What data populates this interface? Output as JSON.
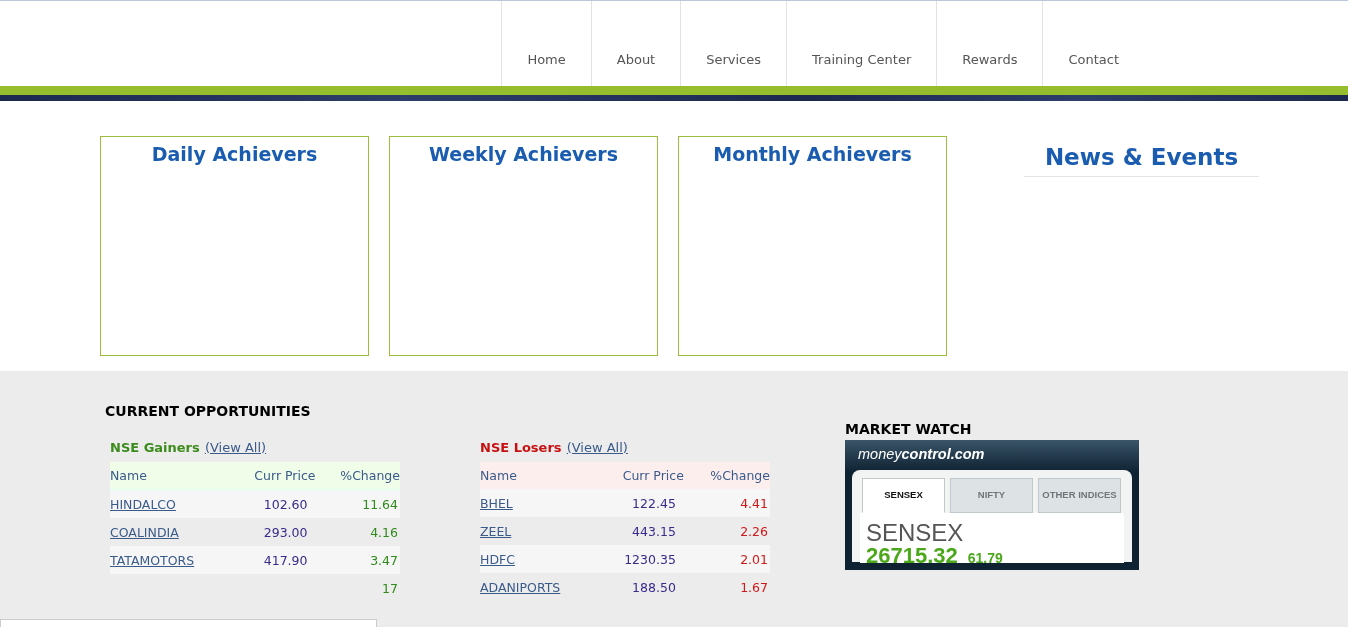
{
  "nav": [
    {
      "label": "Home"
    },
    {
      "label": "About"
    },
    {
      "label": "Services"
    },
    {
      "label": "Training Center"
    },
    {
      "label": "Rewards"
    },
    {
      "label": "Contact"
    }
  ],
  "achievers": [
    {
      "title": "Daily Achievers"
    },
    {
      "title": "Weekly Achievers"
    },
    {
      "title": "Monthly Achievers"
    }
  ],
  "news": {
    "title": "News & Events"
  },
  "opportunities": {
    "title": "CURRENT OPPORTUNITIES",
    "tables": [
      {
        "kind": "gainers",
        "title": "NSE Gainers",
        "link": "(View All)",
        "columns": [
          "Name",
          "Curr Price",
          "%Change"
        ],
        "rows": [
          [
            "HINDALCO",
            "102.60",
            "11.64"
          ],
          [
            "COALINDIA",
            "293.00",
            "4.16"
          ],
          [
            "TATAMOTORS",
            "417.90",
            "3.47"
          ],
          [
            "",
            "",
            "17"
          ]
        ]
      },
      {
        "kind": "losers",
        "title": "NSE Losers",
        "link": "(View All)",
        "columns": [
          "Name",
          "Curr Price",
          "%Change"
        ],
        "rows": [
          [
            "BHEL",
            "122.45",
            "4.41"
          ],
          [
            "ZEEL",
            "443.15",
            "2.26"
          ],
          [
            "HDFC",
            "1230.35",
            "2.01"
          ],
          [
            "ADANIPORTS",
            "188.50",
            "1.67"
          ]
        ]
      }
    ]
  },
  "market_watch": {
    "title": "MARKET WATCH",
    "brand_light": "money",
    "brand_bold": "control.com",
    "tabs": [
      {
        "label": "SENSEX",
        "selected": true
      },
      {
        "label": "NIFTY",
        "selected": false
      },
      {
        "label": "OTHER INDICES",
        "selected": false
      }
    ],
    "index_name": "SENSEX",
    "index_value": "26715.32",
    "index_change": "61.79"
  }
}
